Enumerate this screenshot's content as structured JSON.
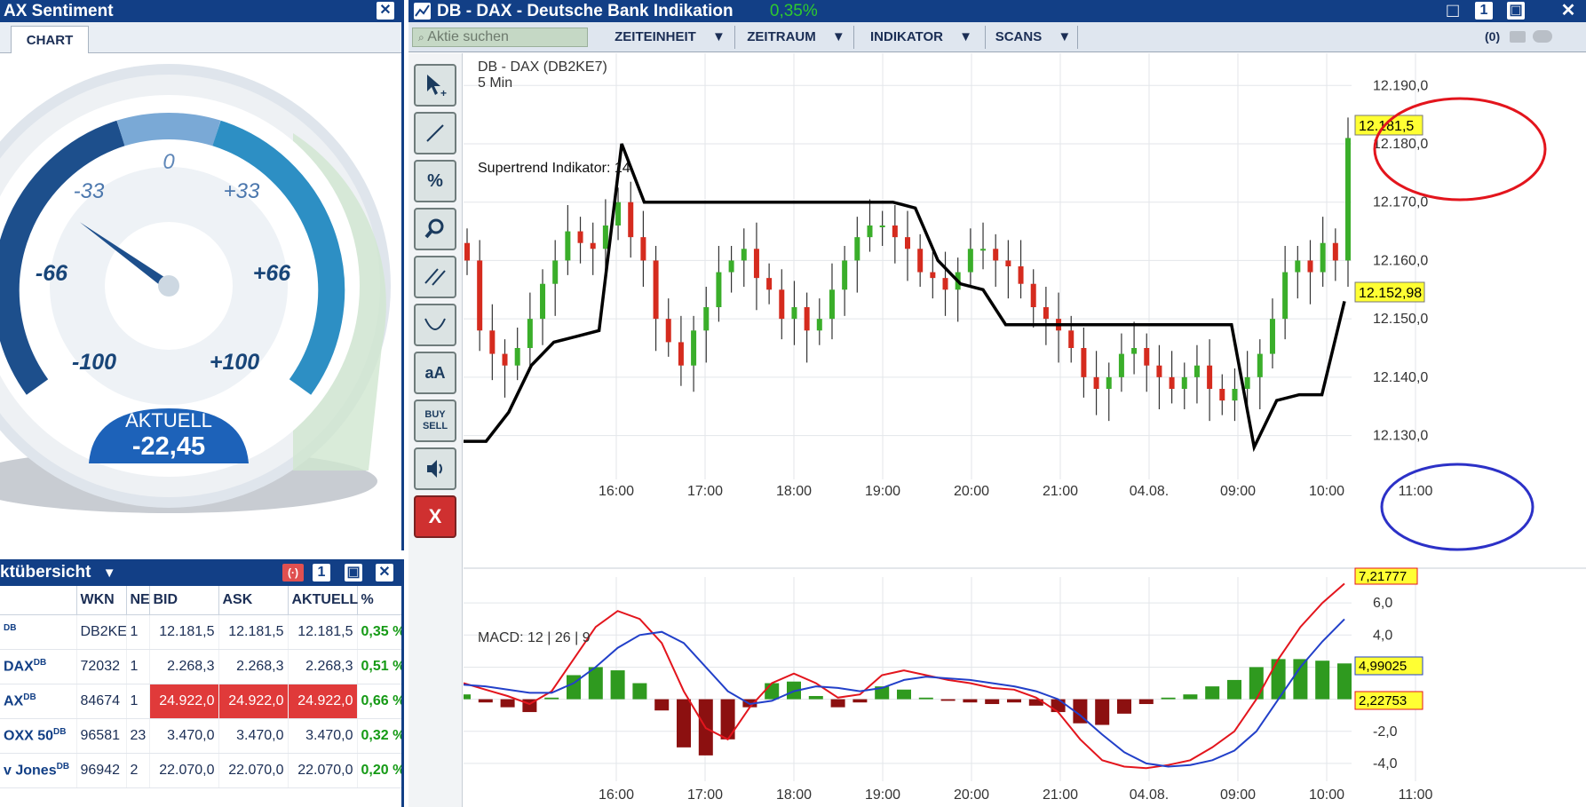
{
  "sentiment": {
    "title": "AX Sentiment",
    "tab": "CHART",
    "close": "✕",
    "scale": [
      "-100",
      "-66",
      "-33",
      "0",
      "+33",
      "+66",
      "+100"
    ],
    "current_label": "AKTUELL",
    "current_value": "-22,45",
    "needle_value": -22.45
  },
  "chart_window": {
    "title": "DB - DAX - Deutsche Bank Indikation",
    "change": "0,35%",
    "buttons": [
      "□",
      "1",
      "▣",
      "✕"
    ],
    "search_placeholder": "Aktie suchen",
    "menus": [
      "ZEITEINHEIT",
      "ZEITRAUM",
      "INDIKATOR",
      "SCANS"
    ],
    "count_label": "(0)",
    "tools": [
      "cursor",
      "line",
      "%",
      "zoom",
      "//",
      "curve",
      "aA",
      "BUY/SELL",
      "speaker",
      "X"
    ]
  },
  "chart_data": [
    {
      "type": "candlestick",
      "title": "DB - DAX (DB2KE7)",
      "subtitle": "5 Min",
      "indicator": "Supertrend Indikator: 14",
      "x_ticks": [
        "16:00",
        "17:00",
        "18:00",
        "19:00",
        "20:00",
        "21:00",
        "04.08.",
        "09:00",
        "10:00",
        "11:00"
      ],
      "y_ticks": [
        "12.190,0",
        "12.180,0",
        "12.170,0",
        "12.160,0",
        "12.150,0",
        "12.140,0",
        "12.130,0"
      ],
      "ylim": [
        12124,
        12194
      ],
      "last_price": "12.181,5",
      "supertrend_label": "12.152,98",
      "close_series": [
        12160,
        12148,
        12144,
        12142,
        12145,
        12150,
        12156,
        12160,
        12165,
        12163,
        12162,
        12166,
        12170,
        12164,
        12160,
        12150,
        12146,
        12142,
        12148,
        12152,
        12158,
        12160,
        12162,
        12157,
        12155,
        12150,
        12152,
        12148,
        12150,
        12155,
        12160,
        12164,
        12166,
        12166,
        12164,
        12162,
        12158,
        12157,
        12155,
        12158,
        12162,
        12162,
        12160,
        12159,
        12156,
        12152,
        12150,
        12148,
        12145,
        12140,
        12138,
        12140,
        12144,
        12145,
        12142,
        12140,
        12138,
        12140,
        12142,
        12138,
        12136,
        12138,
        12140,
        12144,
        12150,
        12158,
        12160,
        12158,
        12163,
        12160,
        12181
      ],
      "supertrend_series": [
        12129,
        12129,
        12134,
        12142,
        12146,
        12147,
        12148,
        12180,
        12170,
        12170,
        12170,
        12170,
        12170,
        12170,
        12170,
        12170,
        12170,
        12170,
        12170,
        12170,
        12169,
        12160,
        12156,
        12155,
        12149,
        12149,
        12149,
        12149,
        12149,
        12149,
        12149,
        12149,
        12149,
        12149,
        12149,
        12128,
        12136,
        12137,
        12137,
        12153
      ]
    },
    {
      "type": "line",
      "title": "MACD: 12 | 26 | 9",
      "y_ticks": [
        "6,0",
        "4,0",
        "2,0",
        "0,0",
        "-2,0",
        "-4,0"
      ],
      "ylim": [
        -5,
        7.5
      ],
      "labels": [
        "7,21777",
        "4,99025",
        "2,22753"
      ],
      "series": [
        {
          "name": "MACD",
          "values": [
            1.0,
            0.6,
            0.2,
            -0.3,
            0.5,
            2.5,
            4.5,
            5.5,
            5.0,
            3.5,
            0.5,
            -1.8,
            -2.5,
            -0.5,
            1.0,
            1.6,
            1.0,
            0.1,
            0.3,
            1.5,
            1.8,
            1.5,
            1.2,
            1.0,
            0.7,
            0.6,
            0.1,
            -0.8,
            -2.5,
            -3.8,
            -4.2,
            -4.3,
            -4.1,
            -3.8,
            -3.0,
            -2.0,
            0.0,
            2.5,
            4.5,
            6.0,
            7.2
          ]
        },
        {
          "name": "Signal",
          "values": [
            0.9,
            0.8,
            0.6,
            0.4,
            0.4,
            1.0,
            2.0,
            3.2,
            4.0,
            4.2,
            3.5,
            2.0,
            0.5,
            -0.3,
            -0.1,
            0.5,
            0.8,
            0.7,
            0.5,
            0.7,
            1.2,
            1.4,
            1.3,
            1.2,
            1.0,
            0.8,
            0.5,
            0.0,
            -1.0,
            -2.2,
            -3.3,
            -4.0,
            -4.2,
            -4.1,
            -3.8,
            -3.2,
            -2.0,
            0.0,
            2.0,
            3.6,
            4.99
          ]
        }
      ],
      "histogram": [
        0.3,
        -0.2,
        -0.5,
        -0.8,
        0.1,
        1.5,
        2.0,
        1.8,
        1.0,
        -0.7,
        -3.0,
        -3.5,
        -2.5,
        -0.5,
        1.0,
        1.1,
        0.2,
        -0.5,
        -0.2,
        0.8,
        0.6,
        0.1,
        -0.1,
        -0.2,
        -0.3,
        -0.2,
        -0.4,
        -0.8,
        -1.5,
        -1.6,
        -0.9,
        -0.3,
        0.1,
        0.3,
        0.8,
        1.2,
        2.0,
        2.5,
        2.5,
        2.4,
        2.23
      ]
    }
  ],
  "market": {
    "title": "ktübersicht",
    "buttons": [
      "(·)",
      "1",
      "▣",
      "✕"
    ],
    "headers": [
      "WKN",
      "NE",
      "BID",
      "ASK",
      "AKTUELL",
      "%"
    ],
    "rows": [
      {
        "name": "",
        "sup": "DB",
        "wkn": "DB2KE",
        "ne": "1",
        "bid": "12.181,5",
        "ask": "12.181,5",
        "cur": "12.181,5",
        "pct": "0,35 %"
      },
      {
        "name": "DAX",
        "sup": "DB",
        "wkn": "72032",
        "ne": "1",
        "bid": "2.268,3",
        "ask": "2.268,3",
        "cur": "2.268,3",
        "pct": "0,51 %"
      },
      {
        "name": "AX",
        "sup": "DB",
        "wkn": "84674",
        "ne": "1",
        "bid": "24.922,0",
        "ask": "24.922,0",
        "cur": "24.922,0",
        "pct": "0,66 %"
      },
      {
        "name": "OXX 50",
        "sup": "DB",
        "wkn": "96581",
        "ne": "23",
        "bid": "3.470,0",
        "ask": "3.470,0",
        "cur": "3.470,0",
        "pct": "0,32 %"
      },
      {
        "name": "v Jones",
        "sup": "DB",
        "wkn": "96942",
        "ne": "2",
        "bid": "22.070,0",
        "ask": "22.070,0",
        "cur": "22.070,0",
        "pct": "0,20 %"
      }
    ]
  },
  "colors": {
    "up": "#3aae2a",
    "down": "#d52b1e",
    "navy": "#123f86",
    "highlight": "#ffff33"
  }
}
